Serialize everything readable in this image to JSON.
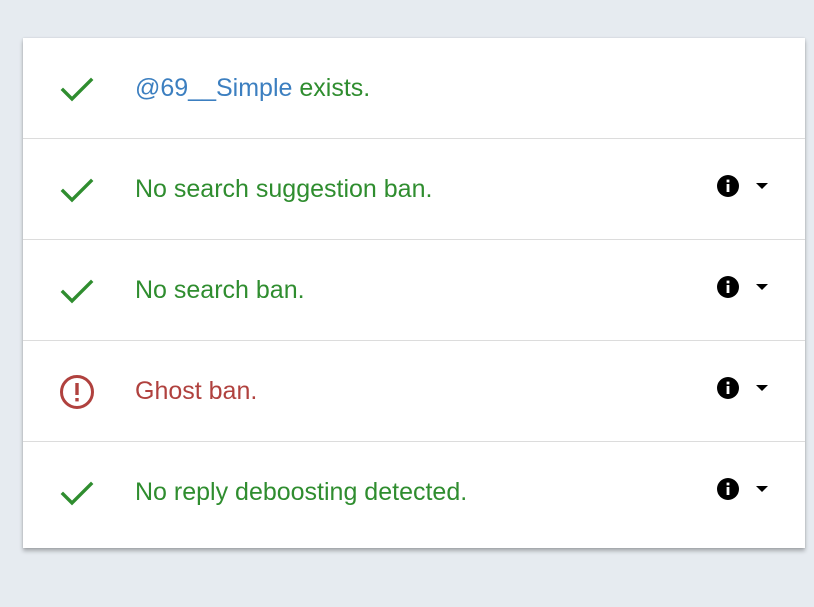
{
  "colors": {
    "ok": "#2f8d2f",
    "bad": "#b0413e",
    "username": "#3c7fc0",
    "background": "#e6ebf0"
  },
  "rows": [
    {
      "status": "ok",
      "status_icon": "check-icon",
      "username": "@69__Simple",
      "text": " exists."
    },
    {
      "status": "ok",
      "status_icon": "check-icon",
      "text": "No search suggestion ban.",
      "info_icon": "info-icon",
      "toggle_icon": "chevron-down-icon"
    },
    {
      "status": "ok",
      "status_icon": "check-icon",
      "text": "No search ban.",
      "info_icon": "info-icon",
      "toggle_icon": "chevron-down-icon"
    },
    {
      "status": "bad",
      "status_icon": "alert-circle-icon",
      "text": "Ghost ban.",
      "info_icon": "info-icon",
      "toggle_icon": "chevron-down-icon"
    },
    {
      "status": "ok",
      "status_icon": "check-icon",
      "text": "No reply deboosting detected.",
      "info_icon": "info-icon",
      "toggle_icon": "chevron-down-icon"
    }
  ]
}
